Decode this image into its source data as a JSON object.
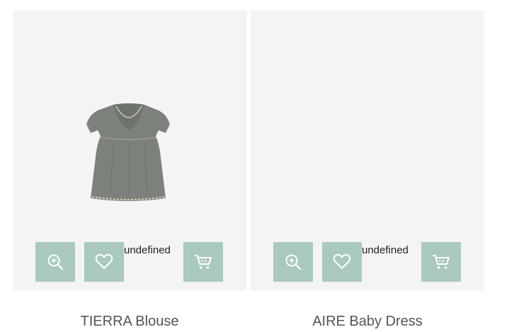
{
  "products": [
    {
      "title": "TIERRA Blouse",
      "has_image": true,
      "action_label": "undefined",
      "icons": {
        "zoom": "zoom-in-icon",
        "wishlist": "heart-icon",
        "cart": "cart-icon"
      }
    },
    {
      "title": "AIRE Baby Dress",
      "has_image": false,
      "action_label": "undefined",
      "icons": {
        "zoom": "zoom-in-icon",
        "wishlist": "heart-icon",
        "cart": "cart-icon"
      }
    }
  ],
  "colors": {
    "card_background": "#f4f4f4",
    "action_button": "#a9c9bf",
    "icon": "#ffffff",
    "title_text": "#555555"
  }
}
